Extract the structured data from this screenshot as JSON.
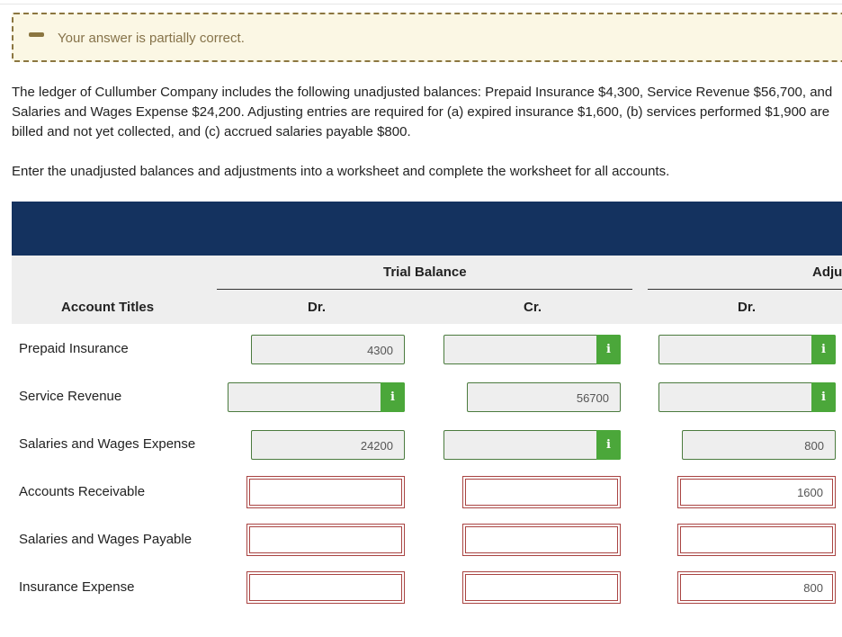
{
  "feedback": {
    "message": "Your answer is partially correct.",
    "status_color": "#8b7640"
  },
  "question": {
    "paragraph1": "The ledger of Cullumber Company includes the following unadjusted balances: Prepaid Insurance $4,300, Service Revenue $56,700, and Salaries and Wages Expense $24,200. Adjusting entries are required for (a) expired insurance $1,600, (b) services performed $1,900 are billed and not yet collected, and (c) accrued salaries payable $800.",
    "paragraph2": "Enter the unadjusted balances and adjustments into a worksheet and complete the worksheet for all accounts."
  },
  "table": {
    "header": {
      "account_titles": "Account Titles",
      "trial_balance": "Trial Balance",
      "adjustments": "Adju",
      "dr": "Dr.",
      "cr": "Cr."
    },
    "rows": [
      {
        "account": "Prepaid Insurance",
        "tb_dr": "4300",
        "tb_cr": "",
        "adj_dr": ""
      },
      {
        "account": "Service Revenue",
        "tb_dr": "",
        "tb_cr": "56700",
        "adj_dr": ""
      },
      {
        "account": "Salaries and Wages Expense",
        "tb_dr": "24200",
        "tb_cr": "",
        "adj_dr": "800"
      },
      {
        "account": "Accounts Receivable",
        "tb_dr": "",
        "tb_cr": "",
        "adj_dr": "1600"
      },
      {
        "account": "Salaries and Wages Payable",
        "tb_dr": "",
        "tb_cr": "",
        "adj_dr": ""
      },
      {
        "account": "Insurance Expense",
        "tb_dr": "",
        "tb_cr": "",
        "adj_dr": "800"
      }
    ]
  },
  "info_icon": "i",
  "colors": {
    "header_band": "#14325f",
    "correct_border": "#4b7b3e",
    "info_green": "#4ba73a",
    "error_red": "#a94442"
  }
}
